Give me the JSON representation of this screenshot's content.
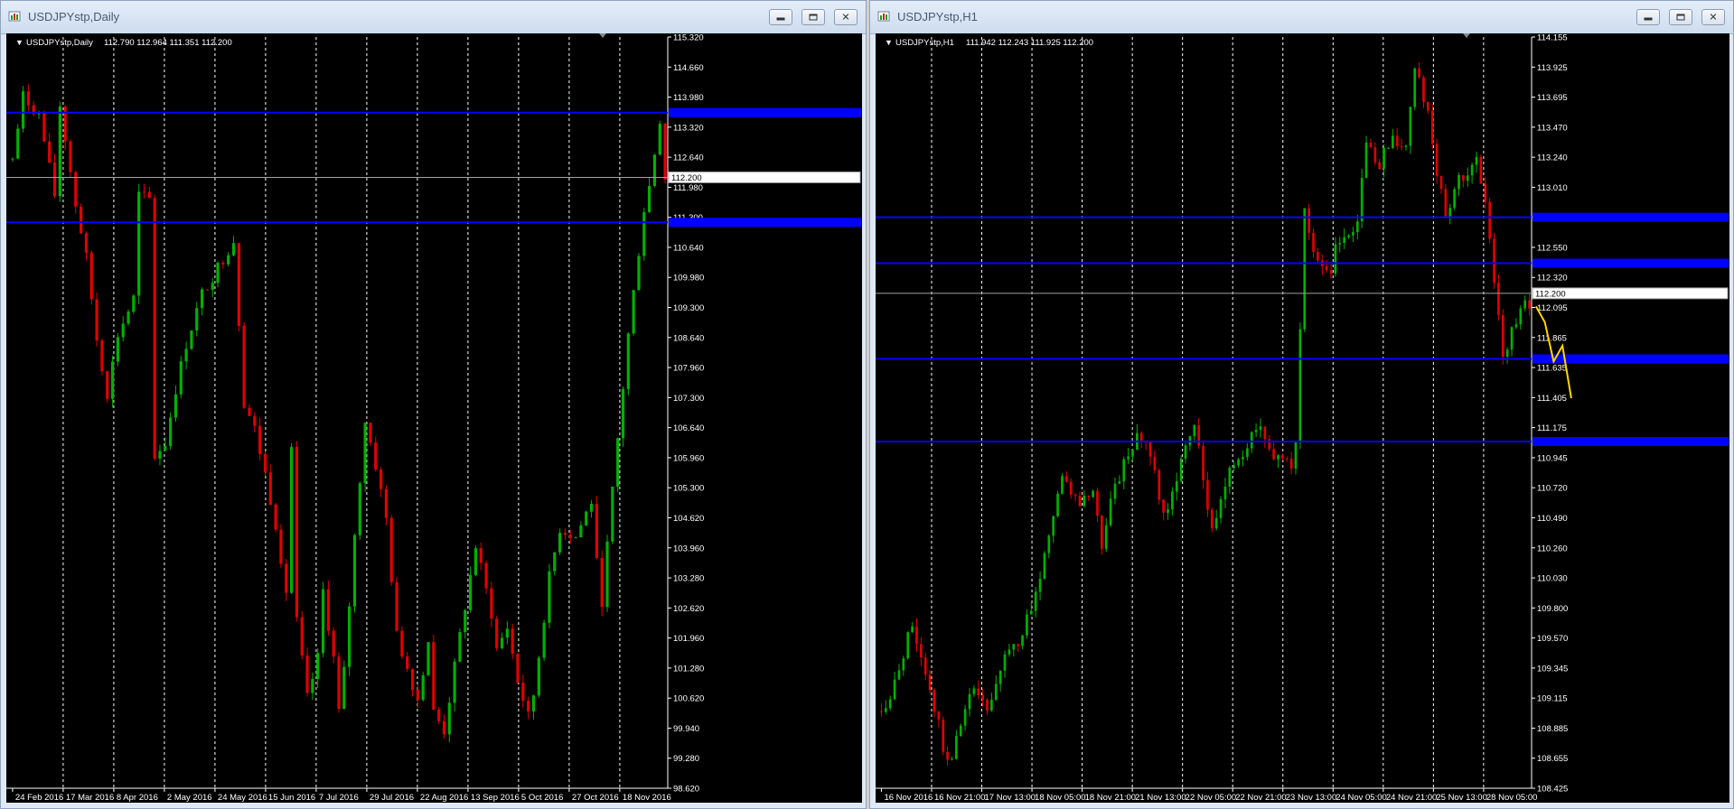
{
  "windows": [
    {
      "title": "USDJPYstp,Daily",
      "symbol_label": "USDJPYstp,Daily",
      "quote": "112.790 112.964 111.351 112.200"
    },
    {
      "title": "USDJPYstp,H1",
      "symbol_label": "USDJPYstp,H1",
      "quote": "111.942 112.243 111.925 112.200"
    }
  ],
  "colors": {
    "background": "#000000",
    "bull_candle": "#00b000",
    "bear_candle": "#e00000",
    "grid": "#ffffff",
    "level_line": "#0000ff",
    "price_line": "#a0a0a0",
    "forecast": "#ffd700",
    "axis_text": "#ffffff"
  },
  "chart_data": [
    {
      "type": "candlestick",
      "ylim": [
        98.62,
        115.32
      ],
      "y_ticks": [
        "115.320",
        "114.660",
        "113.980",
        "113.320",
        "112.640",
        "111.980",
        "111.300",
        "110.640",
        "109.980",
        "109.300",
        "108.640",
        "107.960",
        "107.300",
        "106.640",
        "105.960",
        "105.300",
        "104.620",
        "103.960",
        "103.280",
        "102.620",
        "101.960",
        "101.280",
        "100.620",
        "99.940",
        "99.280",
        "98.620"
      ],
      "x_ticks": [
        "24 Feb 2016",
        "17 Mar 2016",
        "8 Apr 2016",
        "2 May 2016",
        "24 May 2016",
        "15 Jun 2016",
        "7 Jul 2016",
        "29 Jul 2016",
        "22 Aug 2016",
        "13 Sep 2016",
        "5 Oct 2016",
        "27 Oct 2016",
        "18 Nov 2016"
      ],
      "current_price": 112.2,
      "current_price_label": "112.200",
      "horizontal_levels": [
        113.64,
        111.2
      ],
      "waypoints": [
        [
          0,
          112.6
        ],
        [
          2,
          114.0
        ],
        [
          5,
          113.6
        ],
        [
          8,
          111.8
        ],
        [
          9,
          113.8
        ],
        [
          12,
          111.6
        ],
        [
          14,
          110.4
        ],
        [
          16,
          108.6
        ],
        [
          18,
          107.4
        ],
        [
          20,
          108.7
        ],
        [
          23,
          109.5
        ],
        [
          24,
          111.8
        ],
        [
          26,
          111.7
        ],
        [
          27,
          106.0
        ],
        [
          29,
          106.3
        ],
        [
          31,
          107.5
        ],
        [
          33,
          108.5
        ],
        [
          36,
          109.6
        ],
        [
          39,
          110.2
        ],
        [
          42,
          110.8
        ],
        [
          43,
          109.0
        ],
        [
          44,
          107.2
        ],
        [
          46,
          106.6
        ],
        [
          48,
          105.6
        ],
        [
          50,
          104.5
        ],
        [
          52,
          103.0
        ],
        [
          53,
          106.2
        ],
        [
          54,
          102.3
        ],
        [
          56,
          100.6
        ],
        [
          58,
          101.5
        ],
        [
          59,
          103.0
        ],
        [
          61,
          101.5
        ],
        [
          62,
          100.3
        ],
        [
          63,
          101.2
        ],
        [
          65,
          104.2
        ],
        [
          67,
          106.8
        ],
        [
          69,
          105.8
        ],
        [
          71,
          104.6
        ],
        [
          73,
          102.0
        ],
        [
          75,
          101.3
        ],
        [
          77,
          100.6
        ],
        [
          79,
          101.9
        ],
        [
          80,
          100.3
        ],
        [
          82,
          99.9
        ],
        [
          85,
          102.0
        ],
        [
          88,
          104.0
        ],
        [
          91,
          102.5
        ],
        [
          92,
          101.7
        ],
        [
          94,
          102.2
        ],
        [
          96,
          101.0
        ],
        [
          98,
          100.2
        ],
        [
          99,
          100.7
        ],
        [
          102,
          103.3
        ],
        [
          104,
          104.4
        ],
        [
          107,
          104.2
        ],
        [
          110,
          105.0
        ],
        [
          111,
          103.6
        ],
        [
          112,
          102.8
        ],
        [
          114,
          105.2
        ],
        [
          117,
          108.7
        ],
        [
          120,
          111.5
        ],
        [
          121,
          112.0
        ],
        [
          123,
          113.5
        ],
        [
          124,
          112.2
        ]
      ]
    },
    {
      "type": "candlestick",
      "ylim": [
        108.425,
        114.155
      ],
      "y_ticks": [
        "114.155",
        "113.925",
        "113.695",
        "113.470",
        "113.240",
        "113.010",
        "112.780",
        "112.550",
        "112.320",
        "112.095",
        "111.865",
        "111.635",
        "111.405",
        "111.175",
        "110.945",
        "110.720",
        "110.490",
        "110.260",
        "110.030",
        "109.800",
        "109.570",
        "109.345",
        "109.115",
        "108.885",
        "108.655",
        "108.425"
      ],
      "x_ticks": [
        "16 Nov 2016",
        "16 Nov 21:00",
        "17 Nov 13:00",
        "18 Nov 05:00",
        "18 Nov 21:00",
        "21 Nov 13:00",
        "22 Nov 05:00",
        "22 Nov 21:00",
        "23 Nov 13:00",
        "24 Nov 05:00",
        "24 Nov 21:00",
        "25 Nov 13:00",
        "28 Nov 05:00"
      ],
      "current_price": 112.2,
      "current_price_label": "112.200",
      "horizontal_levels": [
        112.78,
        112.43,
        111.7,
        111.07
      ],
      "forecast_path": [
        [
          112.1,
          111.98
        ],
        [
          111.98,
          111.68
        ],
        [
          111.68,
          111.8
        ],
        [
          111.8,
          111.4
        ]
      ],
      "waypoints": [
        [
          0,
          109.0
        ],
        [
          4,
          109.3
        ],
        [
          7,
          109.7
        ],
        [
          10,
          109.3
        ],
        [
          13,
          108.9
        ],
        [
          15,
          108.6
        ],
        [
          17,
          108.8
        ],
        [
          21,
          109.2
        ],
        [
          24,
          109.0
        ],
        [
          28,
          109.4
        ],
        [
          32,
          109.6
        ],
        [
          36,
          110.0
        ],
        [
          38,
          110.4
        ],
        [
          41,
          110.8
        ],
        [
          45,
          110.6
        ],
        [
          48,
          110.7
        ],
        [
          50,
          110.3
        ],
        [
          52,
          110.6
        ],
        [
          55,
          110.9
        ],
        [
          58,
          111.1
        ],
        [
          61,
          111.0
        ],
        [
          64,
          110.5
        ],
        [
          66,
          110.7
        ],
        [
          68,
          110.9
        ],
        [
          71,
          111.2
        ],
        [
          73,
          110.8
        ],
        [
          75,
          110.4
        ],
        [
          77,
          110.6
        ],
        [
          79,
          110.9
        ],
        [
          82,
          111.0
        ],
        [
          85,
          111.2
        ],
        [
          88,
          111.0
        ],
        [
          91,
          110.9
        ],
        [
          93,
          110.9
        ],
        [
          94,
          111.1
        ],
        [
          96,
          112.8
        ],
        [
          98,
          112.5
        ],
        [
          100,
          112.4
        ],
        [
          102,
          112.4
        ],
        [
          103,
          112.6
        ],
        [
          106,
          112.6
        ],
        [
          108,
          112.8
        ],
        [
          110,
          113.3
        ],
        [
          113,
          113.2
        ],
        [
          116,
          113.4
        ],
        [
          119,
          113.3
        ],
        [
          121,
          113.9
        ],
        [
          124,
          113.6
        ],
        [
          126,
          113.1
        ],
        [
          128,
          112.8
        ],
        [
          130,
          113.0
        ],
        [
          132,
          113.1
        ],
        [
          135,
          113.2
        ],
        [
          137,
          112.9
        ],
        [
          139,
          112.3
        ],
        [
          141,
          111.7
        ],
        [
          143,
          111.9
        ],
        [
          145,
          112.1
        ]
      ]
    }
  ]
}
